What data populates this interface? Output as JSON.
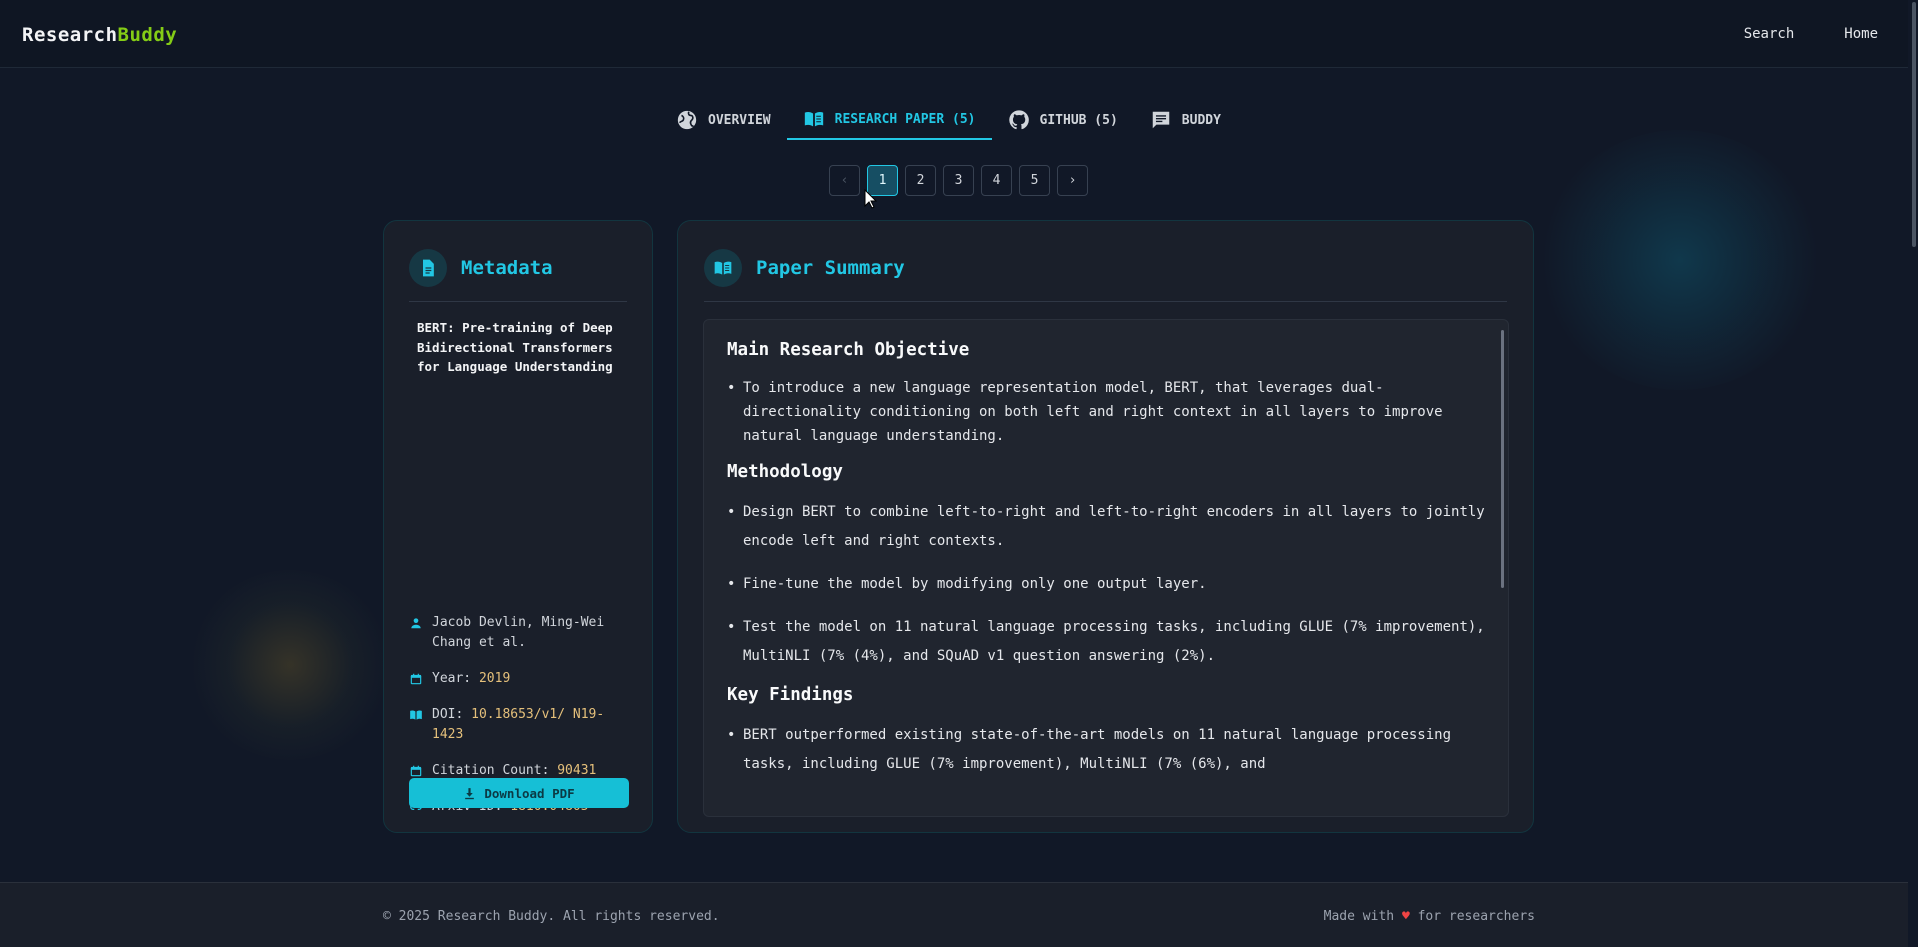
{
  "brand": {
    "part1": "Research",
    "part2": "Buddy"
  },
  "topnav": {
    "search": "Search",
    "home": "Home"
  },
  "tabs": [
    {
      "label": "OVERVIEW",
      "icon": "globe-icon"
    },
    {
      "label": "RESEARCH PAPER (5)",
      "icon": "book-open-icon",
      "active": true
    },
    {
      "label": "GITHUB (5)",
      "icon": "github-icon"
    },
    {
      "label": "BUDDY",
      "icon": "chat-icon"
    }
  ],
  "pagination": {
    "prev": "‹",
    "next": "›",
    "pages": [
      "1",
      "2",
      "3",
      "4",
      "5"
    ],
    "current": "1"
  },
  "metadata": {
    "heading": "Metadata",
    "paper_title": "BERT: Pre-training of Deep Bidirectional Transformers for Language Understanding",
    "authors": "Jacob Devlin, Ming-Wei Chang et al.",
    "year_label": "Year:",
    "year": "2019",
    "doi_label": "DOI:",
    "doi": "10.18653/v1/ N19-1423",
    "citation_label": "Citation Count:",
    "citation_count": "90431",
    "arxiv_label": "Arxiv ID:",
    "arxiv_id": "1810.04805",
    "download_label": "Download PDF"
  },
  "summary": {
    "heading": "Paper Summary",
    "sections": [
      {
        "title": "Main Research Objective",
        "bullets": [
          "To introduce a new language representation model, BERT, that leverages dual-directionality conditioning on both left and right context in all layers to improve natural language understanding."
        ]
      },
      {
        "title": "Methodology",
        "bullets": [
          "Design BERT to combine left-to-right and left-to-right encoders in all layers to jointly encode left and right contexts.",
          "Fine-tune the model by modifying only one output layer.",
          "Test the model on 11 natural language processing tasks, including GLUE (7% improvement), MultiNLI (7% (4%), and SQuAD v1 question answering (2%)."
        ]
      },
      {
        "title": "Key Findings",
        "bullets": [
          "BERT outperformed existing state-of-the-art models on 11 natural language processing tasks, including GLUE (7% improvement), MultiNLI (7% (6%), and"
        ]
      }
    ]
  },
  "footer": {
    "copyright": "© 2025 Research Buddy. All rights reserved.",
    "made_prefix": "Made with",
    "heart": "♥",
    "made_suffix": "for researchers"
  },
  "colors": {
    "accent": "#22c7e4",
    "background": "#111827",
    "highlight": "#e5c07b",
    "brand_green": "#84cc16"
  }
}
